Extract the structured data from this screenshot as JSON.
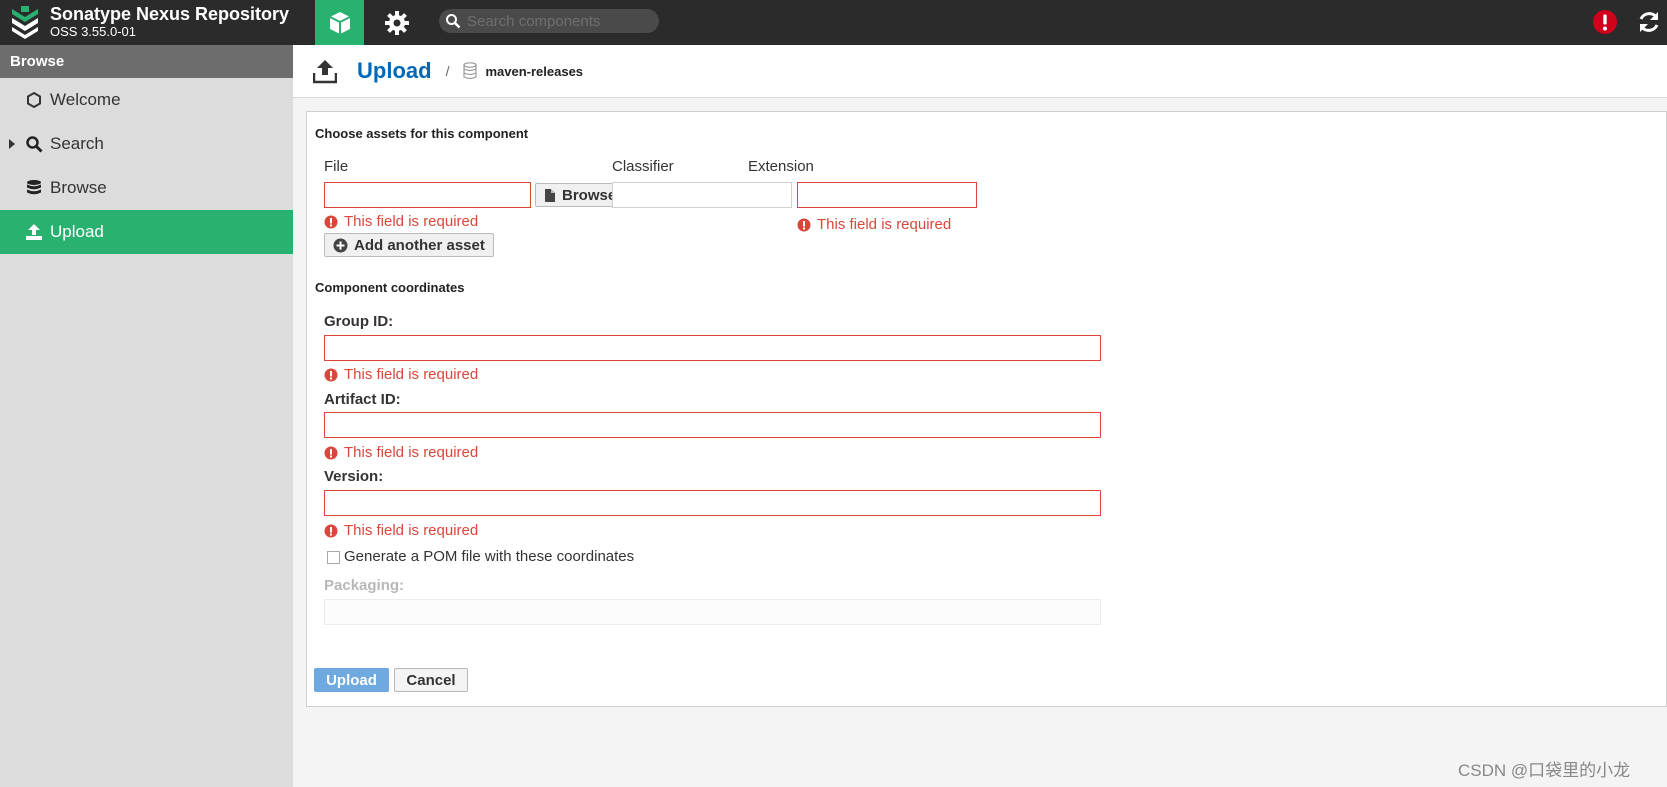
{
  "app": {
    "title": "Sonatype Nexus Repository",
    "version": "OSS 3.55.0-01",
    "search_placeholder": "Search components"
  },
  "colors": {
    "accent": "#28b16f",
    "error": "#d9473a",
    "link": "#0068b8",
    "topbar": "#2b2b2b",
    "alert": "#d0021b"
  },
  "icons": {
    "browse_mode": "cube-icon",
    "admin_mode": "gear-icon",
    "search": "search-icon",
    "alert": "exclamation-circle-icon",
    "refresh": "refresh-icon"
  },
  "sidebar": {
    "header": "Browse",
    "items": [
      {
        "label": "Welcome",
        "icon": "hexagon-icon"
      },
      {
        "label": "Search",
        "icon": "search-icon"
      },
      {
        "label": "Browse",
        "icon": "database-icon"
      },
      {
        "label": "Upload",
        "icon": "upload-icon"
      }
    ]
  },
  "breadcrumb": {
    "title": "Upload",
    "separator": "/",
    "repo": "maven-releases"
  },
  "form": {
    "assets_title": "Choose assets for this component",
    "file_label": "File",
    "classifier_label": "Classifier",
    "extension_label": "Extension",
    "browse_button": "Browse",
    "required_msg": "This field is required",
    "add_asset_button": "Add another asset",
    "coords_title": "Component coordinates",
    "group_label": "Group ID:",
    "artifact_label": "Artifact ID:",
    "version_label": "Version:",
    "pom_checkbox_label": "Generate a POM file with these coordinates",
    "packaging_label": "Packaging:",
    "upload_button": "Upload",
    "cancel_button": "Cancel"
  },
  "watermark": "CSDN @口袋里的小龙"
}
